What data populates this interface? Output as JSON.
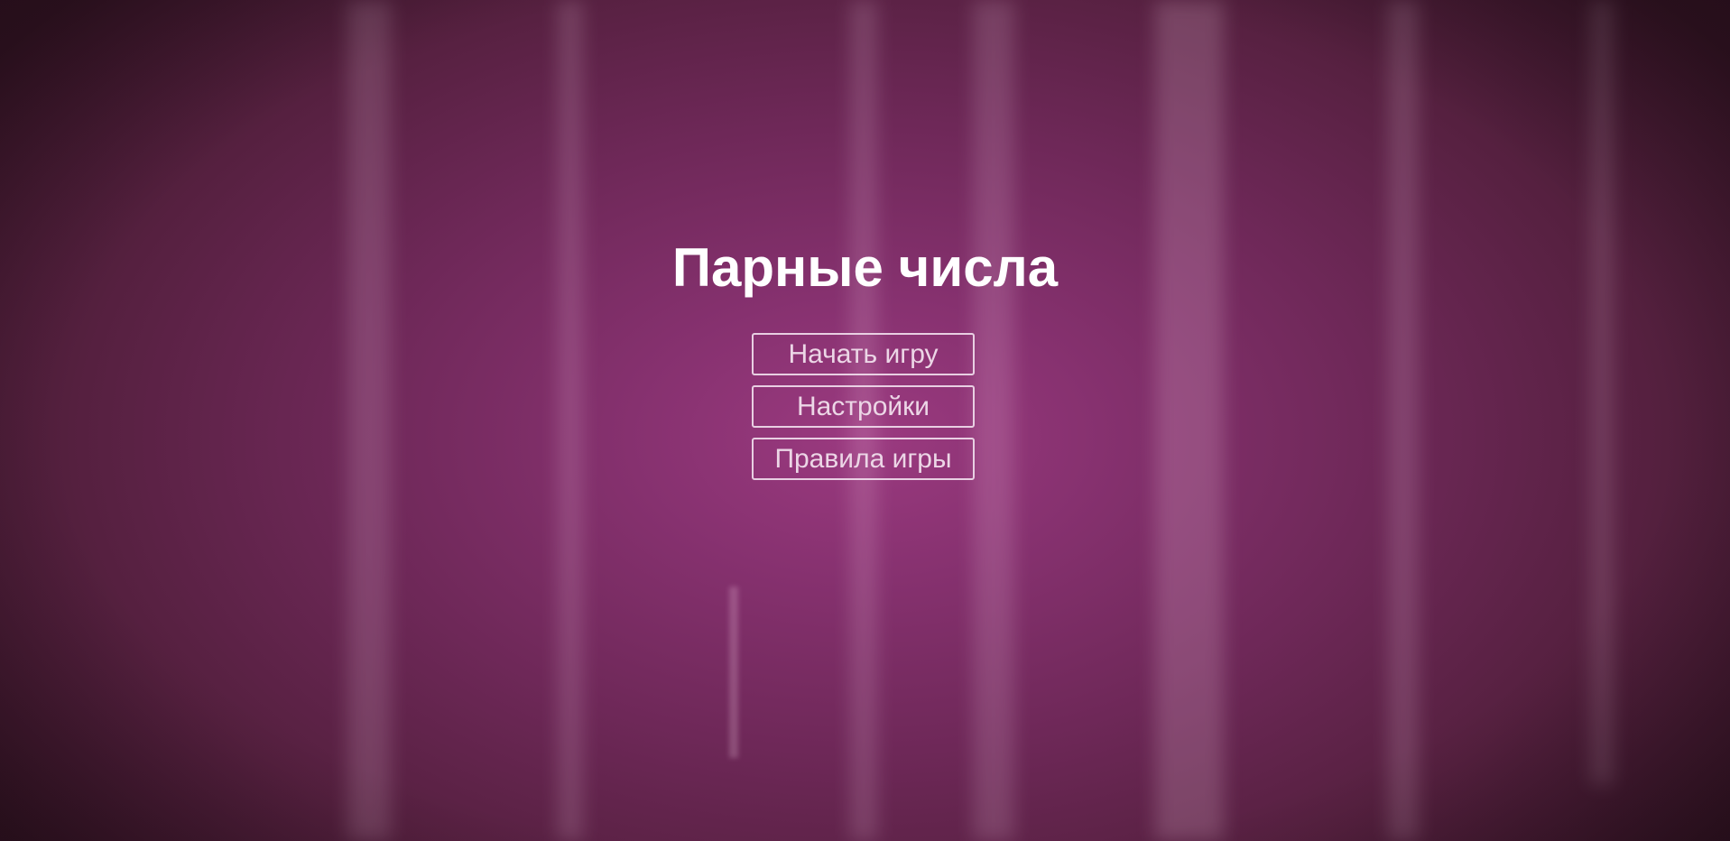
{
  "background": {
    "accent_color": "#9b3a80",
    "edge_color": "#2e1220"
  },
  "menu": {
    "title": "Парные числа",
    "buttons": {
      "start_label": "Начать игру",
      "settings_label": "Настройки",
      "rules_label": "Правила игры"
    }
  }
}
